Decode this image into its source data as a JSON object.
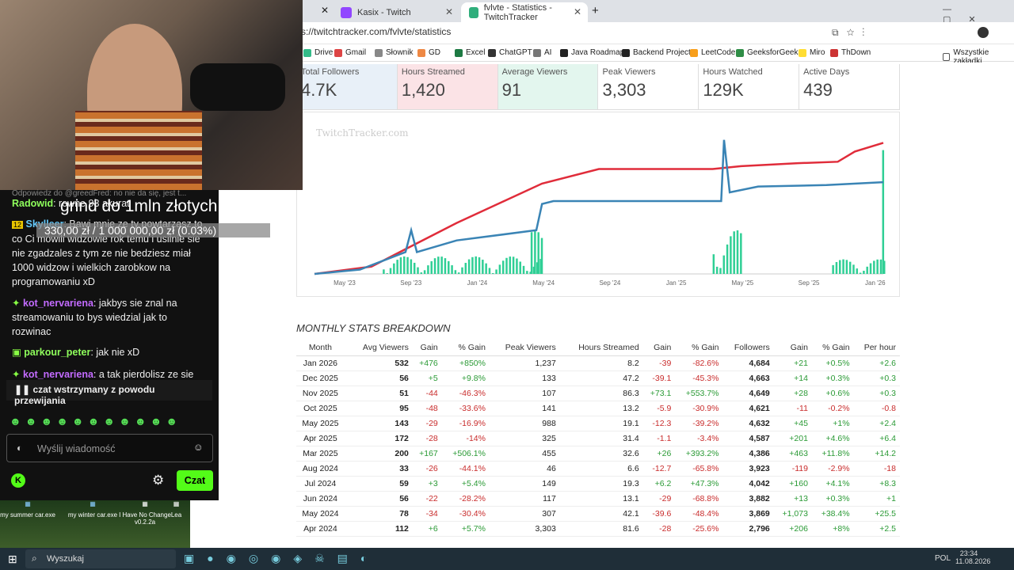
{
  "browser": {
    "tabs": [
      {
        "label": "Kasix - Twitch",
        "active": false
      },
      {
        "label": "fvlvte - Statistics - TwitchTracker",
        "active": true
      }
    ],
    "url": "s://twitchtracker.com/fvlvte/statistics",
    "bookmarks": [
      "Drive",
      "Gmail",
      "Słownik",
      "GD",
      "Excel",
      "ChatGPT",
      "AI",
      "Java Roadmap",
      "Backend Projects",
      "LeetCode",
      "GeeksforGeeks",
      "Miro",
      "ThDown",
      "Wszystkie zakładki"
    ]
  },
  "stats": [
    {
      "label": "Total Followers",
      "value": "4.7K",
      "color": "#e8f0f8"
    },
    {
      "label": "Hours Streamed",
      "value": "1,420",
      "color": "#fbe3e6"
    },
    {
      "label": "Average Viewers",
      "value": "91",
      "color": "#e3f6ee"
    },
    {
      "label": "Peak Viewers",
      "value": "3,303",
      "color": "#ffffff"
    },
    {
      "label": "Hours Watched",
      "value": "129K",
      "color": "#ffffff"
    },
    {
      "label": "Active Days",
      "value": "439",
      "color": "#ffffff"
    }
  ],
  "chart_data": {
    "type": "line",
    "watermark": "TwitchTracker.com",
    "x_ticks": [
      "May '23",
      "Sep '23",
      "Jan '24",
      "May '24",
      "Sep '24",
      "Jan '25",
      "May '25",
      "Sep '25",
      "Jan '26"
    ],
    "series": [
      {
        "color": "#e02c3a",
        "points": [
          [
            0,
            0
          ],
          [
            0.1,
            0.05
          ],
          [
            0.25,
            0.35
          ],
          [
            0.4,
            0.62
          ],
          [
            0.5,
            0.72
          ],
          [
            0.6,
            0.72
          ],
          [
            0.7,
            0.72
          ],
          [
            0.75,
            0.74
          ],
          [
            0.85,
            0.76
          ],
          [
            0.92,
            0.77
          ],
          [
            0.95,
            0.84
          ],
          [
            1,
            0.9
          ]
        ]
      },
      {
        "color": "#3a84b5",
        "points": [
          [
            0,
            0
          ],
          [
            0.08,
            0.03
          ],
          [
            0.16,
            0.15
          ],
          [
            0.17,
            0.3
          ],
          [
            0.18,
            0.15
          ],
          [
            0.25,
            0.23
          ],
          [
            0.39,
            0.3
          ],
          [
            0.4,
            0.48
          ],
          [
            0.42,
            0.5
          ],
          [
            0.58,
            0.5
          ],
          [
            0.7,
            0.5
          ],
          [
            0.715,
            0.5
          ],
          [
            0.72,
            0.92
          ],
          [
            0.73,
            0.56
          ],
          [
            0.78,
            0.6
          ],
          [
            0.9,
            0.61
          ],
          [
            1,
            0.63
          ]
        ]
      }
    ]
  },
  "breakdown": {
    "title": "MONTHLY STATS BREAKDOWN",
    "headers": [
      "Month",
      "Avg Viewers",
      "Gain",
      "% Gain",
      "Peak Viewers",
      "Hours Streamed",
      "Gain",
      "% Gain",
      "Followers",
      "Gain",
      "% Gain",
      "Per hour"
    ],
    "rows": [
      [
        "Jan 2026",
        "532",
        "+476",
        "+850%",
        "1,237",
        "8.2",
        "-39",
        "-82.6%",
        "4,684",
        "+21",
        "+0.5%",
        "+2.6"
      ],
      [
        "Dec 2025",
        "56",
        "+5",
        "+9.8%",
        "133",
        "47.2",
        "-39.1",
        "-45.3%",
        "4,663",
        "+14",
        "+0.3%",
        "+0.3"
      ],
      [
        "Nov 2025",
        "51",
        "-44",
        "-46.3%",
        "107",
        "86.3",
        "+73.1",
        "+553.7%",
        "4,649",
        "+28",
        "+0.6%",
        "+0.3"
      ],
      [
        "Oct 2025",
        "95",
        "-48",
        "-33.6%",
        "141",
        "13.2",
        "-5.9",
        "-30.9%",
        "4,621",
        "-11",
        "-0.2%",
        "-0.8"
      ],
      [
        "May 2025",
        "143",
        "-29",
        "-16.9%",
        "988",
        "19.1",
        "-12.3",
        "-39.2%",
        "4,632",
        "+45",
        "+1%",
        "+2.4"
      ],
      [
        "Apr 2025",
        "172",
        "-28",
        "-14%",
        "325",
        "31.4",
        "-1.1",
        "-3.4%",
        "4,587",
        "+201",
        "+4.6%",
        "+6.4"
      ],
      [
        "Mar 2025",
        "200",
        "+167",
        "+506.1%",
        "455",
        "32.6",
        "+26",
        "+393.2%",
        "4,386",
        "+463",
        "+11.8%",
        "+14.2"
      ],
      [
        "Aug 2024",
        "33",
        "-26",
        "-44.1%",
        "46",
        "6.6",
        "-12.7",
        "-65.8%",
        "3,923",
        "-119",
        "-2.9%",
        "-18"
      ],
      [
        "Jul 2024",
        "59",
        "+3",
        "+5.4%",
        "149",
        "19.3",
        "+6.2",
        "+47.3%",
        "4,042",
        "+160",
        "+4.1%",
        "+8.3"
      ],
      [
        "Jun 2024",
        "56",
        "-22",
        "-28.2%",
        "117",
        "13.1",
        "-29",
        "-68.8%",
        "3,882",
        "+13",
        "+0.3%",
        "+1"
      ],
      [
        "May 2024",
        "78",
        "-34",
        "-30.4%",
        "307",
        "42.1",
        "-39.6",
        "-48.4%",
        "3,869",
        "+1,073",
        "+38.4%",
        "+25.5"
      ],
      [
        "Apr 2024",
        "112",
        "+6",
        "+5.7%",
        "3,303",
        "81.6",
        "-28",
        "-25.6%",
        "2,796",
        "+206",
        "+8%",
        "+2.5"
      ]
    ]
  },
  "overlay": {
    "title": "grind do 1mln złotych",
    "progress": "330,00 zł / 1 000 000,00 zł (0.03%)"
  },
  "chat": {
    "faded": "Odpowiedz do @greedFred: no nie da się, jest t...",
    "messages": [
      {
        "user": "Radowid",
        "text": "rowne 93 akurat"
      },
      {
        "user": "Skylleer",
        "text": "Bawi mnie ze ty powtarzasz to co Ci mówili widzowie rok temu i usilnie sie nie zgadzales z tym ze nie bedziesz miał 1000 widzow i wielkich zarobkow na programowaniu xD"
      },
      {
        "user": "kot_nervariena",
        "text": "jakbys sie znal na streamowaniu to bys wiedzial jak to rozwinac"
      },
      {
        "user": "parkour_peter",
        "text": "jak nie xD"
      },
      {
        "user": "kot_nervariena",
        "text": "a tak pierdolisz ze sie"
      }
    ],
    "paused": "czat wstrzymany z powodu przewijania",
    "input_placeholder": "Wyślij wiadomość",
    "send_label": "Czat"
  },
  "desktop_icons": [
    "my summer car.exe",
    "my winter car.exe",
    "I Have No Change v0.2.2a",
    "Lea"
  ],
  "taskbar": {
    "search": "Wyszukaj",
    "lang": "POL",
    "time": "23:34",
    "date": "11.08.2026"
  }
}
